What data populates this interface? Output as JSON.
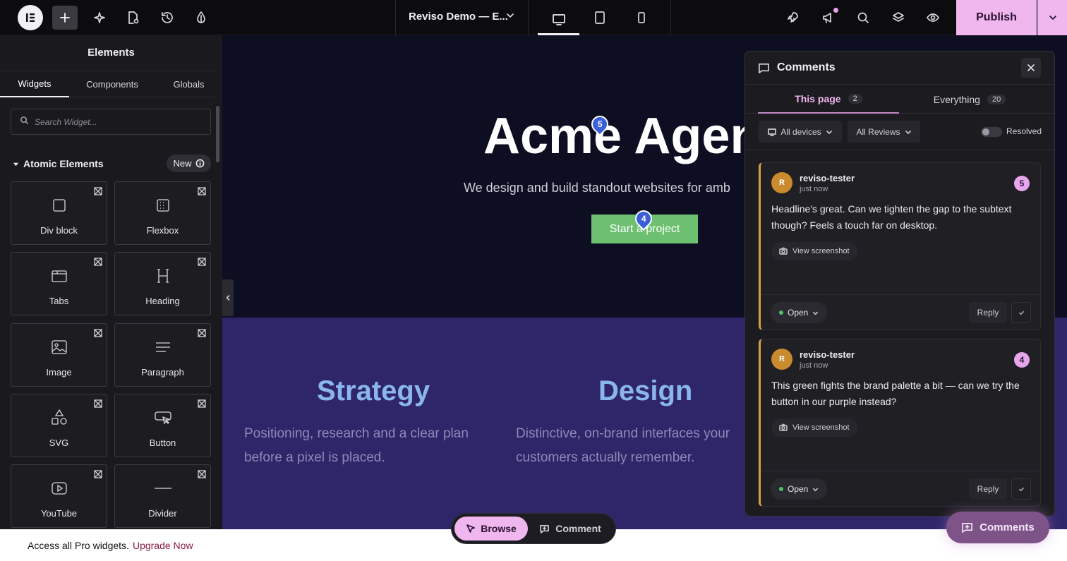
{
  "topbar": {
    "document_title": "Reviso Demo — E...",
    "publish_label": "Publish"
  },
  "panel": {
    "title": "Elements",
    "tabs": [
      "Widgets",
      "Components",
      "Globals"
    ],
    "search_placeholder": "Search Widget...",
    "category": "Atomic Elements",
    "new_badge": "New",
    "widgets": [
      {
        "label": "Div block",
        "icon": "div-block-icon"
      },
      {
        "label": "Flexbox",
        "icon": "flexbox-icon"
      },
      {
        "label": "Tabs",
        "icon": "tabs-icon"
      },
      {
        "label": "Heading",
        "icon": "heading-icon"
      },
      {
        "label": "Image",
        "icon": "image-icon"
      },
      {
        "label": "Paragraph",
        "icon": "paragraph-icon"
      },
      {
        "label": "SVG",
        "icon": "svg-shapes-icon"
      },
      {
        "label": "Button",
        "icon": "button-icon"
      },
      {
        "label": "YouTube",
        "icon": "youtube-icon"
      },
      {
        "label": "Divider",
        "icon": "divider-icon"
      }
    ],
    "promo_text": "Access all Pro widgets.",
    "promo_link": "Upgrade Now"
  },
  "canvas": {
    "hero_title": "Acme Agen",
    "hero_subtitle": "We design and build standout websites for amb",
    "cta_label": "Start a project",
    "pins": [
      "5",
      "4"
    ],
    "services": [
      {
        "title": "Strategy",
        "text": "Positioning, research and a clear plan before a pixel is placed."
      },
      {
        "title": "Design",
        "text": "Distinctive, on-brand interfaces your customers actually remember."
      }
    ]
  },
  "modebar": {
    "browse": "Browse",
    "comment": "Comment"
  },
  "comments_panel": {
    "title": "Comments",
    "tabs": [
      {
        "label": "This page",
        "count": "2"
      },
      {
        "label": "Everything",
        "count": "20"
      }
    ],
    "filter_devices": "All devices",
    "filter_reviews": "All Reviews",
    "resolved_label": "Resolved",
    "comments": [
      {
        "avatar": "R",
        "author": "reviso-tester",
        "time": "just now",
        "number": "5",
        "text": "Headline's great. Can we tighten the gap to the subtext though? Feels a touch far on desktop.",
        "screenshot_label": "View screenshot",
        "status": "Open",
        "reply_label": "Reply"
      },
      {
        "avatar": "R",
        "author": "reviso-tester",
        "time": "just now",
        "number": "4",
        "text": "This green fights the brand palette a bit — can we try the button in our purple instead?",
        "screenshot_label": "View screenshot",
        "status": "Open",
        "reply_label": "Reply"
      }
    ]
  },
  "fab_label": "Comments",
  "colors": {
    "accent_pink": "#f0b6ee",
    "cta_green": "#6cc070",
    "service_title_blue": "#8ab6ee",
    "services_bg": "#2f266a",
    "hero_bg": "#0e0e22",
    "card_accent": "#d4a14a",
    "pin_blue": "#3a5fd9"
  }
}
